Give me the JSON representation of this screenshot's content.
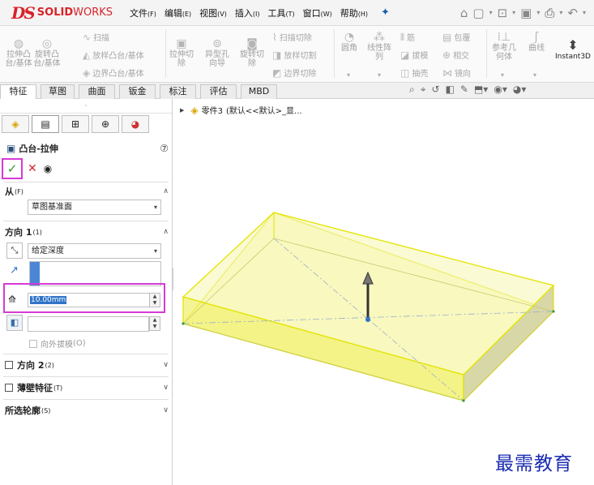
{
  "app": {
    "logo_ds": "DS",
    "logo_solid": "SOLID",
    "logo_works": "WORKS"
  },
  "menu": [
    {
      "label": "文件",
      "key": "(F)"
    },
    {
      "label": "编辑",
      "key": "(E)"
    },
    {
      "label": "视图",
      "key": "(V)"
    },
    {
      "label": "插入",
      "key": "(I)"
    },
    {
      "label": "工具",
      "key": "(T)"
    },
    {
      "label": "窗口",
      "key": "(W)"
    },
    {
      "label": "帮助",
      "key": "(H)"
    }
  ],
  "ribbon": {
    "extrude_boss": "拉伸凸\n台/基体",
    "revolve_boss": "旋转凸\n台/基体",
    "sweep": "扫描",
    "loft": "放样凸台/基体",
    "boundary": "边界凸台/基体",
    "extrude_cut": "拉伸切\n除",
    "hole_wizard": "异型孔\n向导",
    "revolve_cut": "旋转切\n除",
    "sweep_cut": "扫描切除",
    "loft_cut": "放样切割",
    "boundary_cut": "边界切除",
    "fillet": "圆角",
    "linear_pattern": "线性阵\n列",
    "rib": "筋",
    "draft": "拔模",
    "shell": "抽壳",
    "wrap": "包覆",
    "intersect": "相交",
    "mirror": "镜向",
    "ref_geometry": "参考几\n何体",
    "curves": "曲线",
    "instant3d": "Instant3D"
  },
  "tabs": [
    "特征",
    "草图",
    "曲面",
    "钣金",
    "标注",
    "评估",
    "MBD"
  ],
  "panel": {
    "feature_title": "凸台-拉伸",
    "from_label": "从",
    "from_key": "(F)",
    "from_value": "草图基准面",
    "dir1_label": "方向 1",
    "dir1_key": "(1)",
    "end_condition": "给定深度",
    "depth": "10.00mm",
    "draft_outward": "向外拔模",
    "draft_outward_key": "(O)",
    "dir2_label": "方向 2",
    "dir2_key": "(2)",
    "thin_label": "薄壁特征",
    "thin_key": "(T)",
    "contours_label": "所选轮廓",
    "contours_key": "(S)"
  },
  "tree": {
    "part": "零件3",
    "config": "(默认<<默认>_显..."
  },
  "watermark": "最需教育",
  "colors": {
    "accent_highlight": "#d63ad6",
    "model_fill": "#f2f27a",
    "model_edge": "#e0e000",
    "logo_red": "#d8232a"
  }
}
